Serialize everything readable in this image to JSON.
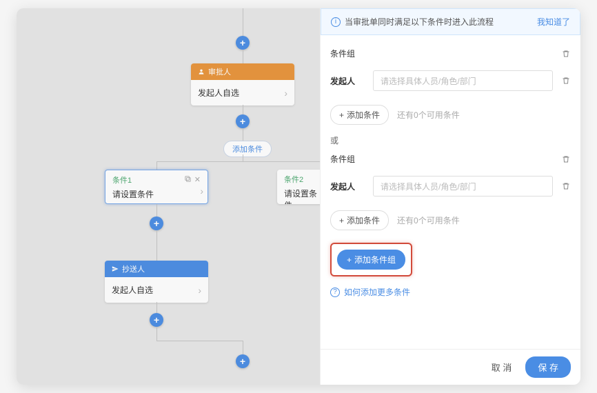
{
  "banner": {
    "text": "当审批单同时满足以下条件时进入此流程",
    "ack": "我知道了"
  },
  "groups": [
    {
      "title": "条件组",
      "field_label": "发起人",
      "placeholder": "请选择具体人员/角色/部门",
      "add_cond": "添加条件",
      "hint": "还有0个可用条件"
    },
    {
      "title": "条件组",
      "field_label": "发起人",
      "placeholder": "请选择具体人员/角色/部门",
      "add_cond": "添加条件",
      "hint": "还有0个可用条件"
    }
  ],
  "or_text": "或",
  "add_group_btn": "添加条件组",
  "help_text": "如何添加更多条件",
  "footer": {
    "cancel": "取 消",
    "save": "保 存"
  },
  "flow": {
    "approver": {
      "header": "审批人",
      "body": "发起人自选"
    },
    "add_condition_pill": "添加条件",
    "cond1": {
      "title": "条件1",
      "text": "请设置条件"
    },
    "cond2": {
      "title": "条件2",
      "text": "请设置条件"
    },
    "cc": {
      "header": "抄送人",
      "body": "发起人自选"
    }
  },
  "chart_data": null
}
